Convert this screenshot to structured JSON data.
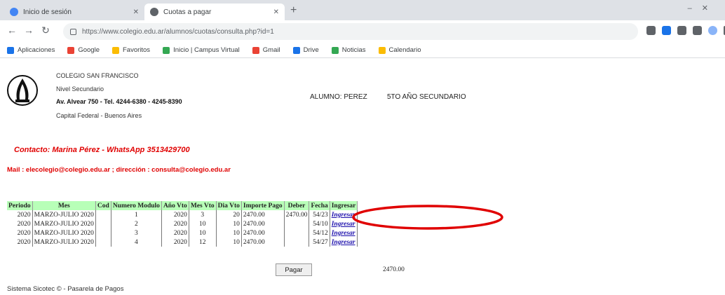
{
  "browser": {
    "tabs": [
      {
        "title": "Inicio de sesión",
        "active": false,
        "favicon_color": "#4285f4"
      },
      {
        "title": "Cuotas a pagar",
        "active": true,
        "favicon_color": "#5f6368"
      }
    ],
    "new_tab_label": "+",
    "url": "https://www.colegio.edu.ar/alumnos/cuotas/consulta.php?id=1",
    "bookmarks": [
      {
        "label": "Aplicaciones",
        "color": "#1a73e8"
      },
      {
        "label": "Google",
        "color": "#ea4335"
      },
      {
        "label": "Favoritos",
        "color": "#fbbc04"
      },
      {
        "label": "Inicio | Campus Virtual",
        "color": "#34a853"
      },
      {
        "label": "Gmail",
        "color": "#ea4335"
      },
      {
        "label": "Drive",
        "color": "#1a73e8"
      },
      {
        "label": "Noticias",
        "color": "#34a853"
      },
      {
        "label": "Calendario",
        "color": "#fbbc04"
      }
    ]
  },
  "header": {
    "school_name": "COLEGIO SAN FRANCISCO",
    "school_sub": "Nivel Secundario",
    "address": "Av. Alvear 750 - Tel. 4244-6380 - 4245-8390",
    "city": "Capital Federal - Buenos Aires",
    "banner_left": "ALUMNO: PEREZ",
    "banner_right": "5TO AÑO SECUNDARIO"
  },
  "contact": {
    "line": "Contacto: Marina Pérez - WhatsApp 3513429700",
    "mail": "Mail : elecolegio@colegio.edu.ar ; dirección : consulta@colegio.edu.ar"
  },
  "table": {
    "headers": [
      "Periodo",
      "Mes",
      "Cod",
      "Numero Modulo",
      "Año Vto",
      "Mes Vto",
      "Dia Vto",
      "Importe Pago",
      "Deber",
      "Fecha",
      "Ingresar"
    ],
    "rows": [
      [
        "2020",
        "MARZO-JULIO 2020",
        "",
        "1",
        "2020",
        "3",
        "20",
        "2470.00",
        "2470.00",
        "54/23",
        "Ingresar"
      ],
      [
        "2020",
        "MARZO-JULIO 2020",
        "",
        "2",
        "2020",
        "10",
        "10",
        "2470.00",
        "",
        "54/10",
        "Ingresar"
      ],
      [
        "2020",
        "MARZO-JULIO 2020",
        "",
        "3",
        "2020",
        "10",
        "10",
        "2470.00",
        "",
        "54/12",
        "Ingresar"
      ],
      [
        "2020",
        "MARZO-JULIO 2020",
        "",
        "4",
        "2020",
        "12",
        "10",
        "2470.00",
        "",
        "54/27",
        "Ingresar"
      ]
    ]
  },
  "pagar_label": "Pagar",
  "total": "2470.00",
  "footer": "Sistema Sicotec © - Pasarela de Pagos",
  "annotation_color": "#e00000"
}
